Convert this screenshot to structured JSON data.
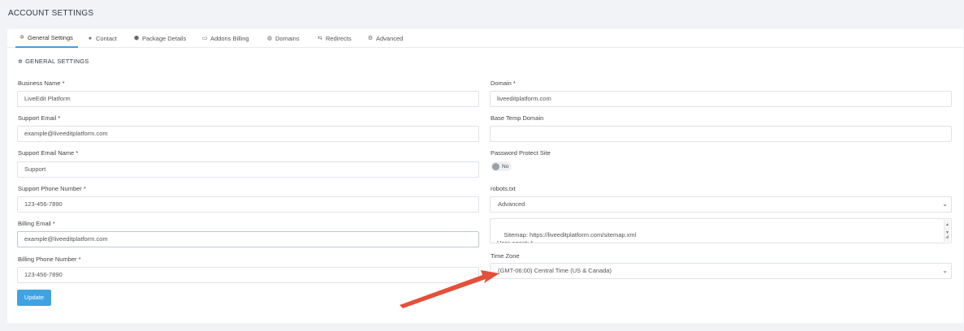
{
  "page_title": "ACCOUNT SETTINGS",
  "tabs": [
    {
      "label": "General Settings",
      "icon": "gear-icon",
      "active": true
    },
    {
      "label": "Contact",
      "icon": "user-icon"
    },
    {
      "label": "Package Details",
      "icon": "package-icon"
    },
    {
      "label": "Addons Billing",
      "icon": "card-icon"
    },
    {
      "label": "Domains",
      "icon": "globe-icon"
    },
    {
      "label": "Redirects",
      "icon": "redirect-icon"
    },
    {
      "label": "Advanced",
      "icon": "advanced-icon"
    }
  ],
  "section_title": "GENERAL SETTINGS",
  "left": {
    "business_name": {
      "label": "Business Name *",
      "value": "LiveEdit Platform"
    },
    "support_email": {
      "label": "Support Email *",
      "value": "example@liveeditplatform.com"
    },
    "support_email_name": {
      "label": "Support Email Name *",
      "value": "Support"
    },
    "support_phone": {
      "label": "Support Phone Number *",
      "value": "123-456-7890"
    },
    "billing_email": {
      "label": "Billing Email *",
      "value": "example@liveeditplatform.com"
    },
    "billing_phone": {
      "label": "Billing Phone Number *",
      "value": "123-456-7890"
    }
  },
  "right": {
    "domain": {
      "label": "Domain *",
      "value": "liveeditplatform.com"
    },
    "base_temp_domain": {
      "label": "Base Temp Domain",
      "value": ""
    },
    "password_protect": {
      "label": "Password Protect Site",
      "toggle_label": "No",
      "enabled": false
    },
    "robots": {
      "label": "robots.txt",
      "mode": "Advanced",
      "content": "Sitemap: https://liveeditplatform.com/sitemap.xml\nUser-agent: *\nDisallow:"
    },
    "time_zone": {
      "label": "Time Zone",
      "value": "(GMT-06:00) Central Time (US & Canada)"
    }
  },
  "update_button": "Update",
  "colors": {
    "accent": "#3fa3e3",
    "arrow": "#e4503a"
  }
}
